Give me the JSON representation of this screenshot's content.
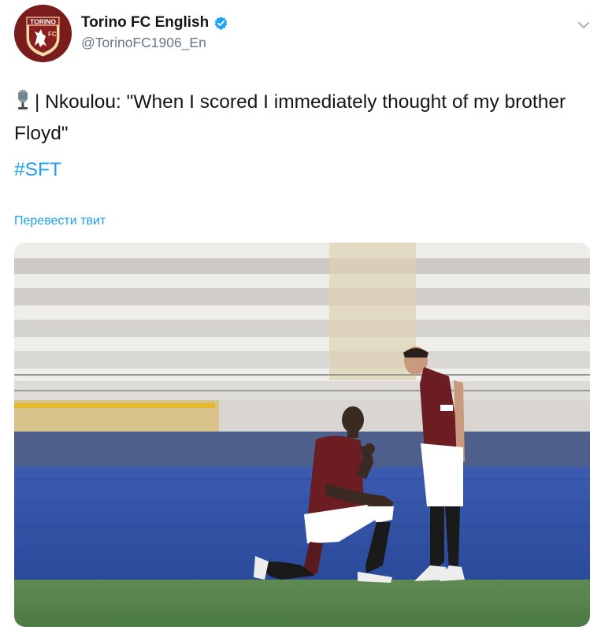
{
  "tweet": {
    "display_name": "Torino FC English",
    "handle": "@TorinoFC1906_En",
    "text": "| Nkoulou: \"When I scored I immediately thought of my brother Floyd\"",
    "hashtag": "#SFT",
    "translate_label": "Перевести твит",
    "avatar_label": "TORINO",
    "avatar_sublabel": "FC"
  },
  "icons": {
    "verified": "verified-badge-icon",
    "menu": "chevron-down-icon",
    "microphone": "studio-microphone-icon"
  },
  "colors": {
    "link": "#1da1f2",
    "verified": "#1da1f2",
    "club": "#7a1c1c",
    "secondary_text": "#657786"
  }
}
